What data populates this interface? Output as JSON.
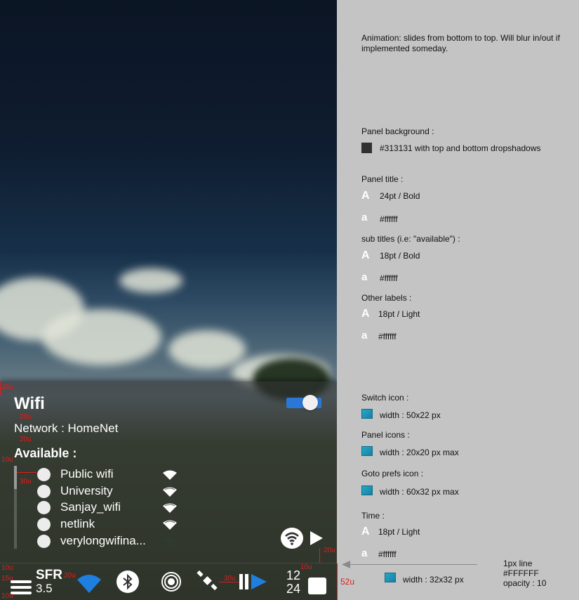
{
  "panel": {
    "title": "Wifi",
    "network_label": "Network : HomeNet",
    "available_title": "Available :",
    "networks": [
      {
        "name": "Public wifi",
        "signal": "full"
      },
      {
        "name": "University",
        "signal": "full"
      },
      {
        "name": "Sanjay_wifi",
        "signal": "full"
      },
      {
        "name": "netlink",
        "signal": "full"
      },
      {
        "name": "verylongwifina...",
        "signal": "weak"
      }
    ],
    "switch_on": true,
    "accent_color": "#2a77d6"
  },
  "taskbar": {
    "carrier": "SFR",
    "signal_value": "3.5",
    "clock_hours": "12",
    "clock_minutes": "24"
  },
  "annotations": {
    "a_top": "20u",
    "a_title": "20u",
    "a_network": "20u",
    "a_list": "10u",
    "a_indent": "30u",
    "a_bottom": "20u",
    "a_taskbar_top": "10u",
    "a_taskbar_mid": "15u",
    "a_taskbar_bottom": "10u",
    "a_carrier_gap": "20u",
    "a_play_gap": "30u",
    "a_clock_gap": "10u",
    "a_height": "52u"
  },
  "spec": {
    "animation": "Animation: slides from bottom to top. Will blur in/out if implemented someday.",
    "panel_bg_title": "Panel background :",
    "panel_bg_value": "#313131 with top and bottom dropshadows",
    "panel_title_title": "Panel title :",
    "panel_title_font": "24pt / Bold",
    "panel_title_color": "#ffffff",
    "subtitles_title": "sub titles (i.e: \"available\") :",
    "subtitles_font": "18pt / Bold",
    "subtitles_color": "#ffffff",
    "other_title": "Other labels :",
    "other_font": "18pt / Light",
    "other_color": "#ffffff",
    "switch_title": "Switch icon :",
    "switch_value": "width : 50x22 px",
    "panel_icons_title": "Panel icons :",
    "panel_icons_value": "width : 20x20 px max",
    "goto_title": "Goto prefs icon :",
    "goto_value": "width : 60x32 px max",
    "time_title": "Time :",
    "time_font": "18pt / Light",
    "time_color": "#ffffff",
    "line_note_1": "1px line",
    "line_note_2": "#FFFFFF",
    "line_note_3": "opacity : 10",
    "taskbar_icon_value": "width : 32x32 px",
    "font_glyph_upper": "A",
    "font_glyph_lower": "a"
  }
}
